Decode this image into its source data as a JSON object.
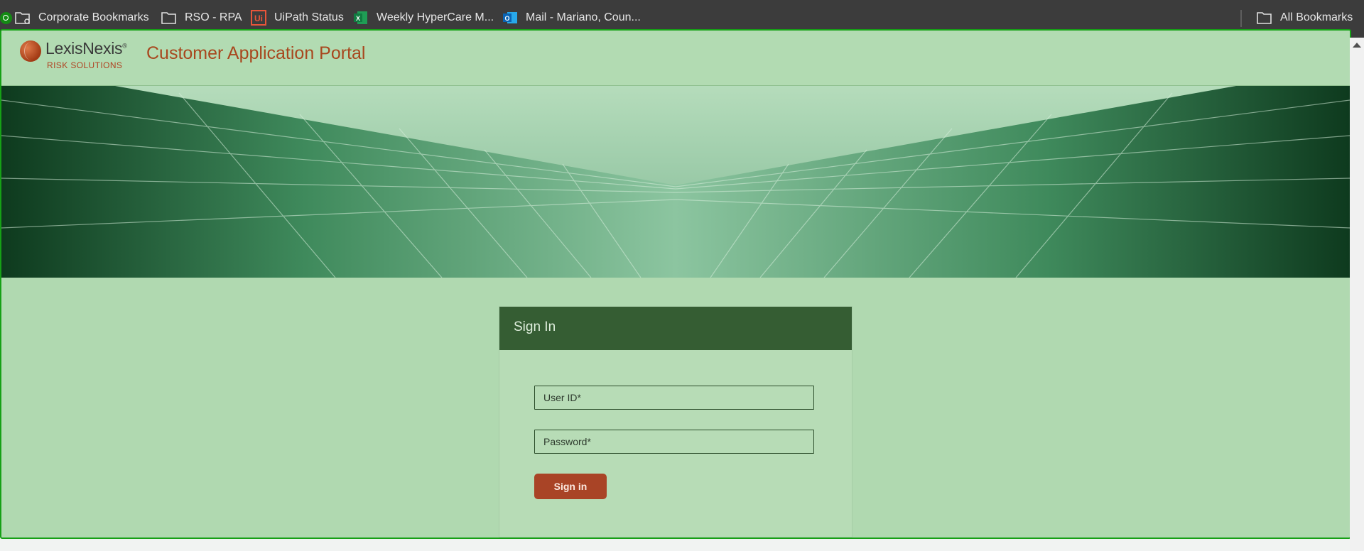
{
  "bookmarks_bar": {
    "items": [
      {
        "label": "Corporate Bookmarks",
        "icon": "folder-gear-icon"
      },
      {
        "label": "RSO - RPA",
        "icon": "folder-icon"
      },
      {
        "label": "UiPath Status",
        "icon": "uipath-icon"
      },
      {
        "label": "Weekly HyperCare M...",
        "icon": "excel-icon"
      },
      {
        "label": "Mail - Mariano, Coun...",
        "icon": "outlook-icon"
      }
    ],
    "all_bookmarks": {
      "label": "All Bookmarks",
      "icon": "folder-icon"
    }
  },
  "header": {
    "logo_name": "LexisNexis",
    "logo_mark": "®",
    "logo_subtitle": "RISK SOLUTIONS",
    "portal_title": "Customer Application Portal"
  },
  "signin": {
    "title": "Sign In",
    "user_id_placeholder": "User ID*",
    "password_placeholder": "Password*",
    "button_label": "Sign in"
  },
  "colors": {
    "accent": "#a94426",
    "header_green": "#355d33",
    "page_green": "#b0d9b0",
    "frame_border": "#16a016"
  }
}
